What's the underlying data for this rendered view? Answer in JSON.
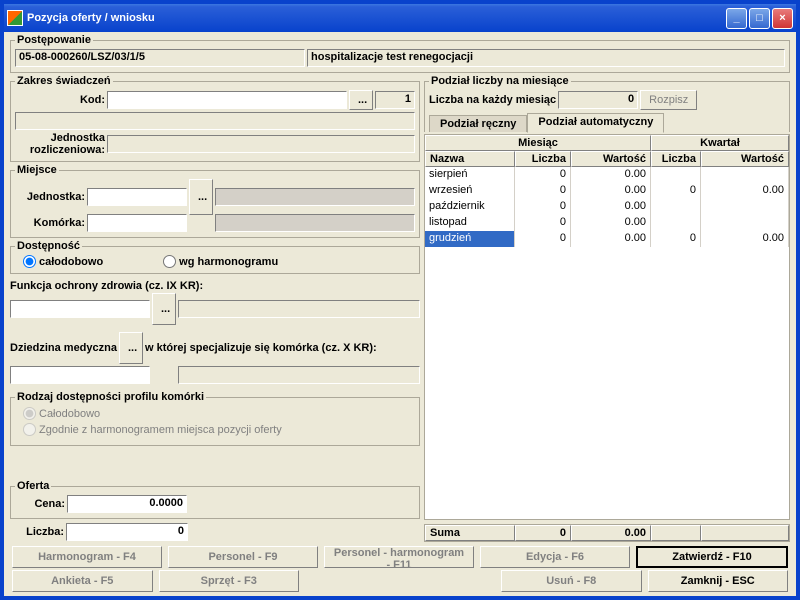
{
  "titlebar": {
    "title": "Pozycja oferty / wniosku"
  },
  "postepowanie": {
    "legend": "Postępowanie",
    "code": "05-08-000260/LSZ/03/1/5",
    "desc": "hospitalizacje test renegocjacji"
  },
  "zakres": {
    "legend": "Zakres świadczeń",
    "kod_label": "Kod:",
    "kod_value": "",
    "index": "1",
    "ellipsis": "...",
    "jednostka_rozl_label": "Jednostka\nrozliczeniowa:",
    "jednostka_rozl_value": ""
  },
  "miejsce": {
    "legend": "Miejsce",
    "jednostka_label": "Jednostka:",
    "komorka_label": "Komórka:",
    "ellipsis": "..."
  },
  "dostepnosc": {
    "legend": "Dostępność",
    "opt1": "całodobowo",
    "opt2": "wg harmonogramu"
  },
  "funkcja": {
    "label": "Funkcja ochrony zdrowia (cz. IX KR):",
    "ellipsis": "..."
  },
  "dziedzina": {
    "label1": "Dziedzina medyczna",
    "label2": "w której specjalizuje się komórka (cz. X KR):",
    "ellipsis": "..."
  },
  "rodzaj": {
    "legend": "Rodzaj dostępności profilu komórki",
    "opt1": "Całodobowo",
    "opt2": "Zgodnie z harmonogramem miejsca pozycji oferty"
  },
  "oferta": {
    "legend": "Oferta",
    "cena_label": "Cena:",
    "cena_value": "0.0000",
    "liczba_label": "Liczba:",
    "liczba_value": "0"
  },
  "podzial": {
    "legend": "Podział liczby na miesiące",
    "liczba_label": "Liczba na każdy miesiąc",
    "liczba_value": "0",
    "rozpisz": "Rozpisz",
    "tab1": "Podział ręczny",
    "tab2": "Podział automatyczny"
  },
  "grid": {
    "h_miesiac": "Miesiąc",
    "h_kwartal": "Kwartał",
    "h_nazwa": "Nazwa",
    "h_liczba": "Liczba",
    "h_wartosc": "Wartość",
    "rows": [
      {
        "nazwa": "sierpień",
        "liczba": "0",
        "wartosc": "0.00",
        "kliczba": "",
        "kwartosc": ""
      },
      {
        "nazwa": "wrzesień",
        "liczba": "0",
        "wartosc": "0.00",
        "kliczba": "0",
        "kwartosc": "0.00"
      },
      {
        "nazwa": "październik",
        "liczba": "0",
        "wartosc": "0.00",
        "kliczba": "",
        "kwartosc": ""
      },
      {
        "nazwa": "listopad",
        "liczba": "0",
        "wartosc": "0.00",
        "kliczba": "",
        "kwartosc": ""
      },
      {
        "nazwa": "grudzień",
        "liczba": "0",
        "wartosc": "0.00",
        "kliczba": "0",
        "kwartosc": "0.00"
      }
    ],
    "suma_label": "Suma",
    "suma_liczba": "0",
    "suma_wartosc": "0.00"
  },
  "buttons": {
    "harmonogram": "Harmonogram - F4",
    "personel": "Personel - F9",
    "personel_harm": "Personel - harmonogram - F11",
    "edycja": "Edycja - F6",
    "zatwierdz": "Zatwierdź - F10",
    "ankieta": "Ankieta - F5",
    "sprzet": "Sprzęt - F3",
    "usun": "Usuń - F8",
    "zamknij": "Zamknij - ESC"
  }
}
